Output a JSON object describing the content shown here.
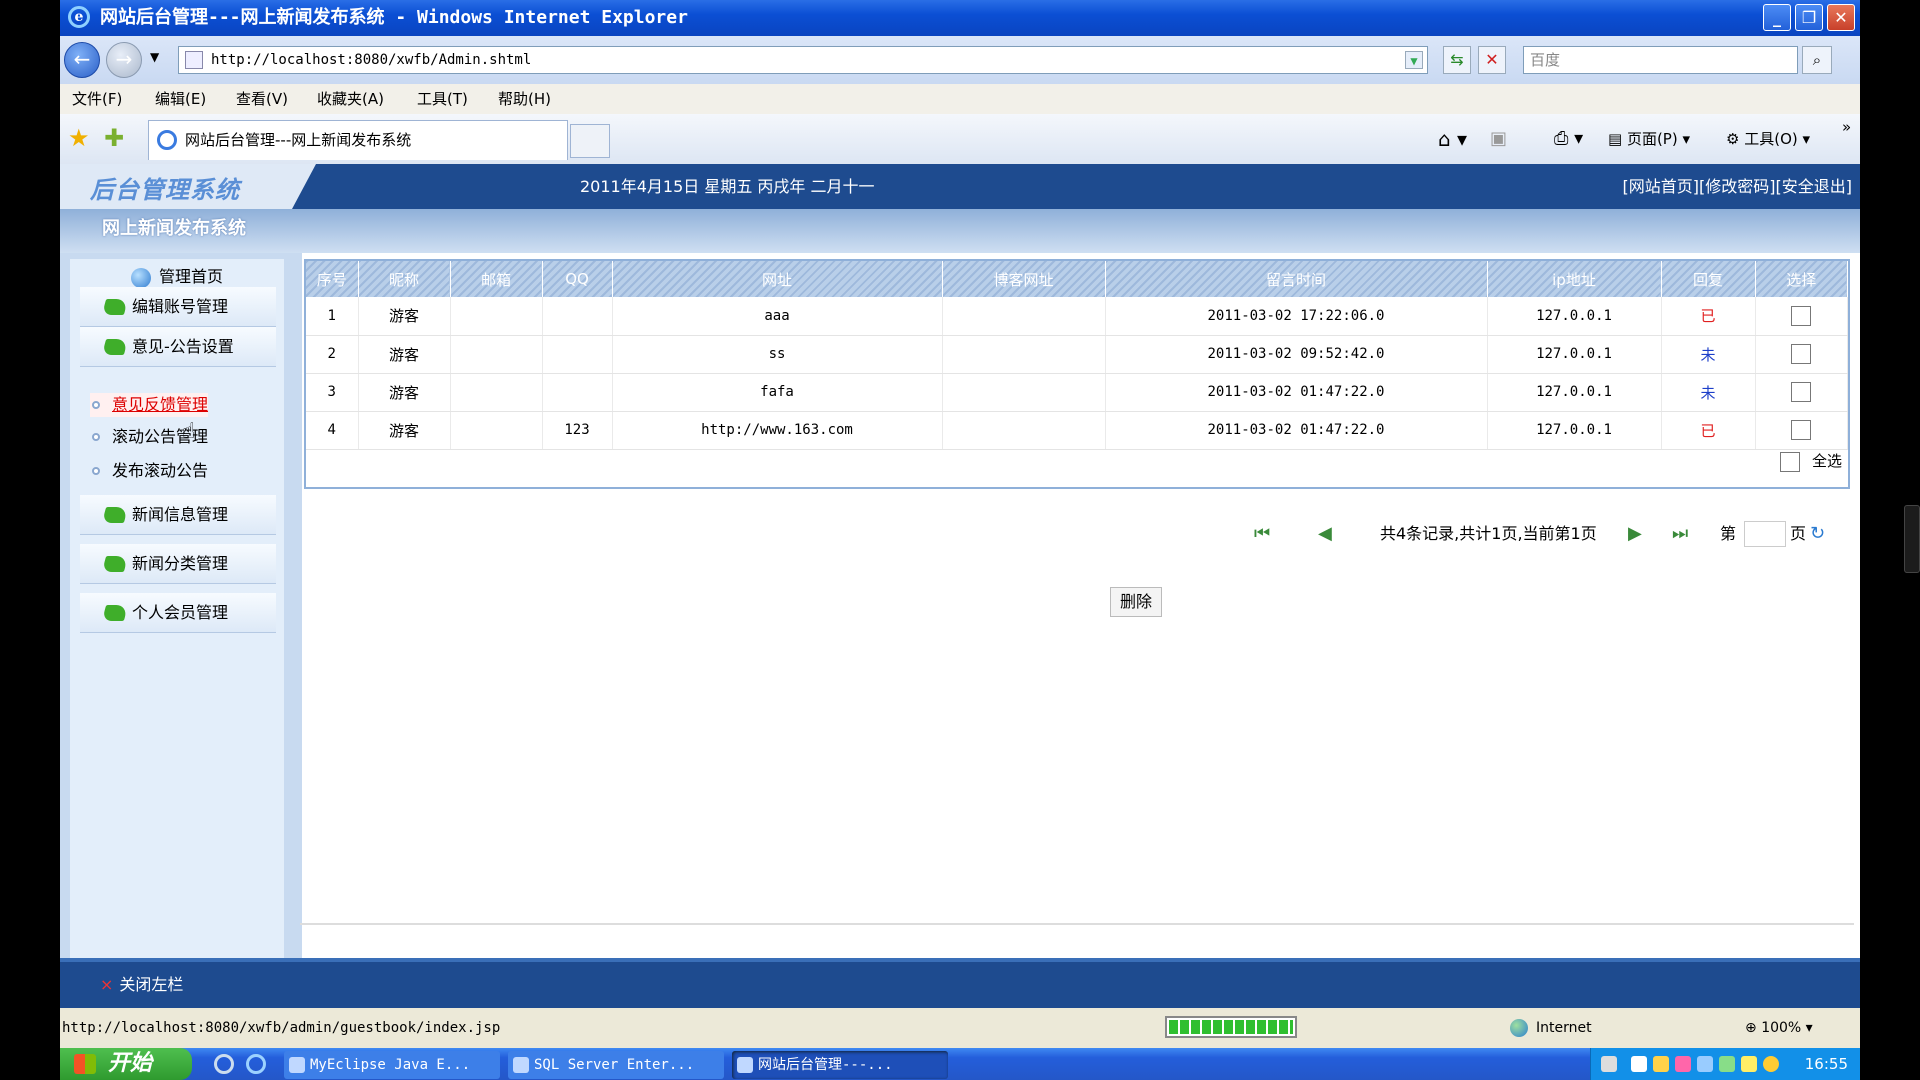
{
  "window": {
    "title": "网站后台管理---网上新闻发布系统 - Windows Internet Explorer",
    "address": "http://localhost:8080/xwfb/Admin.shtml",
    "search_placeholder": "百度",
    "menu": [
      "文件(F)",
      "编辑(E)",
      "查看(V)",
      "收藏夹(A)",
      "工具(T)",
      "帮助(H)"
    ],
    "tab_title": "网站后台管理---网上新闻发布系统",
    "tools": {
      "page": "页面(P)",
      "tools": "工具(O)"
    }
  },
  "header": {
    "logo": "后台管理系统",
    "datetime": "2011年4月15日 星期五 丙戌年 二月十一",
    "links": "[网站首页][修改密码][安全退出]",
    "site_name": "网上新闻发布系统"
  },
  "sidebar": {
    "home": "管理首页",
    "groups": [
      "编辑账号管理",
      "意见-公告设置",
      "新闻信息管理",
      "新闻分类管理",
      "个人会员管理"
    ],
    "sublinks": [
      "意见反馈管理",
      "滚动公告管理",
      "发布滚动公告"
    ]
  },
  "table": {
    "headers": [
      "序号",
      "昵称",
      "邮箱",
      "QQ",
      "网址",
      "博客网址",
      "留言时间",
      "ip地址",
      "回复",
      "选择"
    ],
    "rows": [
      {
        "no": "1",
        "nick": "游客",
        "email": "",
        "qq": "",
        "url": "aaa",
        "blog": "",
        "time": "2011-03-02 17:22:06.0",
        "ip": "127.0.0.1",
        "reply": "已"
      },
      {
        "no": "2",
        "nick": "游客",
        "email": "",
        "qq": "",
        "url": "ss",
        "blog": "",
        "time": "2011-03-02 09:52:42.0",
        "ip": "127.0.0.1",
        "reply": "未"
      },
      {
        "no": "3",
        "nick": "游客",
        "email": "",
        "qq": "",
        "url": "fafa",
        "blog": "",
        "time": "2011-03-02 01:47:22.0",
        "ip": "127.0.0.1",
        "reply": "未"
      },
      {
        "no": "4",
        "nick": "游客",
        "email": "",
        "qq": "123",
        "url": "http://www.163.com",
        "blog": "",
        "time": "2011-03-02 01:47:22.0",
        "ip": "127.0.0.1",
        "reply": "已"
      }
    ],
    "select_all": "全选"
  },
  "pager": {
    "info": "共4条记录,共计1页,当前第1页",
    "page_prefix": "第",
    "page_suffix": "页"
  },
  "delete_button": "删除",
  "close_left": "关闭左栏",
  "statusbar": {
    "url": "http://localhost:8080/xwfb/admin/guestbook/index.jsp",
    "zone": "Internet",
    "zoom": "100%"
  },
  "taskbar": {
    "start": "开始",
    "items": [
      "MyEclipse Java E...",
      "SQL Server Enter...",
      "网站后台管理---..."
    ],
    "clock": "16:55"
  },
  "colors": {
    "header_blue": "#1e4b8f",
    "reply_done": "#e02020",
    "reply_pending": "#1d3fc9",
    "active_link": "#dd0000"
  }
}
